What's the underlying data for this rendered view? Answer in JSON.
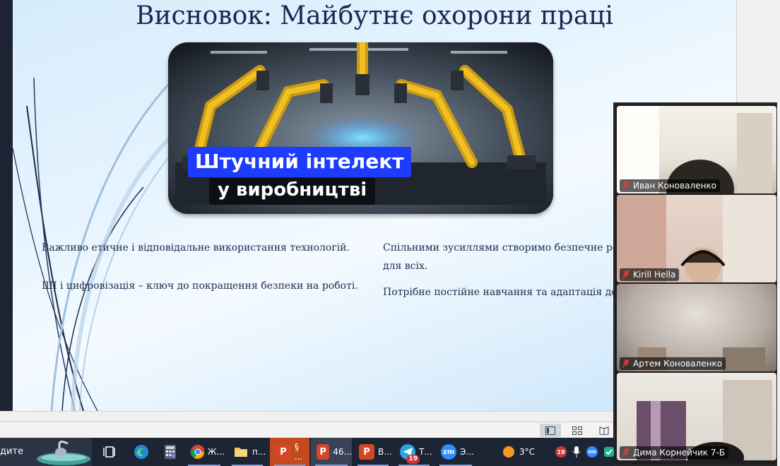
{
  "slide": {
    "title": "Висновок: Майбутнє охорони праці",
    "hero": {
      "line1": "Штучний інтелект",
      "line2": "у виробництві"
    },
    "left_bullets": [
      "Важливо етичне і відповідальне використання технологій.",
      "ШІ і цифровізація – ключ до покращення безпеки на роботі."
    ],
    "right_bullets": [
      "Спільними зусиллями створимо безпечне роб",
      "для всіх.",
      "Потрібне постійне навчання та адаптація до н"
    ]
  },
  "gallery": {
    "participants": [
      {
        "name": "Иван Коноваленко",
        "muted": true
      },
      {
        "name": "Kirill Hella",
        "muted": true
      },
      {
        "name": "Артем Коноваленко",
        "muted": true
      },
      {
        "name": "Дима Корнейчик 7-Б",
        "muted": true
      }
    ]
  },
  "taskbar": {
    "search_text": "дите",
    "apps": [
      {
        "icon": "task-view-icon",
        "label": ""
      },
      {
        "icon": "edge-icon",
        "label": ""
      },
      {
        "icon": "calculator-icon",
        "label": ""
      },
      {
        "icon": "chrome-icon",
        "label": "Ж..."
      },
      {
        "icon": "file-explorer-icon",
        "label": "п..."
      },
      {
        "icon": "powerpoint-icon",
        "label": "§ ..."
      },
      {
        "icon": "powerpoint-icon",
        "label": "46..."
      },
      {
        "icon": "powerpoint-icon",
        "label": "В..."
      },
      {
        "icon": "telegram-icon",
        "label": "Т...",
        "badge": "19"
      },
      {
        "icon": "zoom-icon",
        "label": "Э..."
      }
    ],
    "weather": "3°C",
    "tray_badge": "19"
  },
  "colors": {
    "title": "#1a2750",
    "hero_label_bg": "#1e3cff",
    "taskbar_bg": "#1d2434",
    "mute_red": "#e03c3c"
  }
}
